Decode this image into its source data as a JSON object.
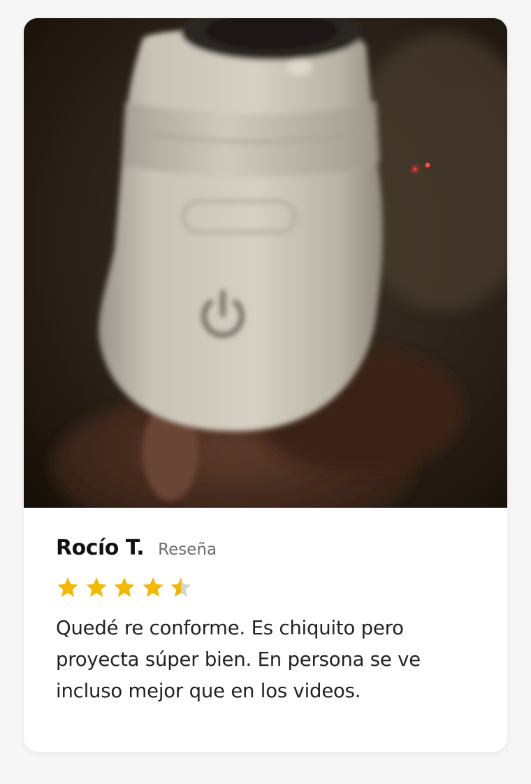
{
  "review": {
    "reviewer_name": "Rocío T.",
    "tag": "Reseña",
    "rating": 4.5,
    "rating_max": 5,
    "text": "Quedé re conforme. Es chiquito pero proyecta súper bien. En persona se ve incluso mejor que en los videos.",
    "photo_icon": "power-icon"
  },
  "colors": {
    "star_filled": "#f5b800",
    "star_empty": "#d4d4d4",
    "card_bg": "#ffffff",
    "page_bg": "#f6f6f6"
  }
}
